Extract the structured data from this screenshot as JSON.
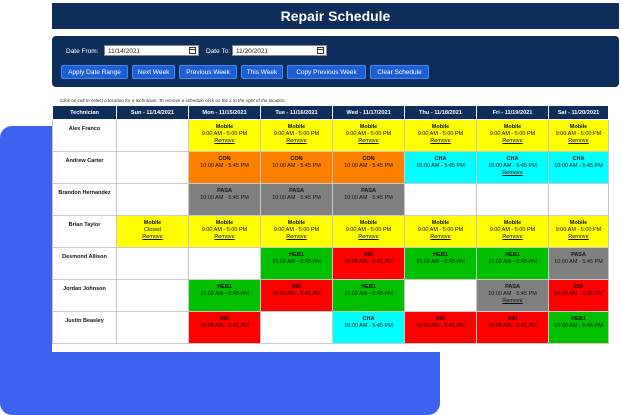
{
  "title": "Repair Schedule",
  "filters": {
    "date_from_label": "Date From:",
    "date_from_value": "11/14/2021",
    "date_to_label": "Date To:",
    "date_to_value": "11/20/2021",
    "buttons": [
      "Apply Date Range",
      "Next Week",
      "Previous Week",
      "This Week",
      "Copy Previous Week",
      "Clear Schedule"
    ]
  },
  "hint": "Click on cell to select a location for a technician. To remove a schedule click on the x to the right of the location.",
  "table": {
    "headers": [
      "Technician",
      "Sun - 11/14/2021",
      "Mon - 11/15/2021",
      "Tue - 11/16/2021",
      "Wed - 11/17/2021",
      "Thu - 11/18/2021",
      "Fri - 11/19/2021",
      "Sat - 11/20/2021"
    ],
    "remove_label": "Remove",
    "rows": [
      {
        "tech": "Alex Franco",
        "cells": [
          {
            "color": "empty"
          },
          {
            "color": "yellow",
            "loc": "Mobile",
            "time": "9:00 AM - 5:00 PM",
            "remove": true
          },
          {
            "color": "yellow",
            "loc": "Mobile",
            "time": "9:00 AM - 5:00 PM",
            "remove": true
          },
          {
            "color": "yellow",
            "loc": "Mobile",
            "time": "9:00 AM - 5:00 PM",
            "remove": true
          },
          {
            "color": "yellow",
            "loc": "Mobile",
            "time": "9:00 AM - 5:00 PM",
            "remove": true
          },
          {
            "color": "yellow",
            "loc": "Mobile",
            "time": "9:00 AM - 5:00 PM",
            "remove": true
          },
          {
            "color": "yellow",
            "loc": "Mobile",
            "time": "9:00 AM - 5:00 PM",
            "remove": true
          }
        ]
      },
      {
        "tech": "Andrew Carter",
        "cells": [
          {
            "color": "empty"
          },
          {
            "color": "orange",
            "loc": "CON",
            "time": "10:00 AM - 5:45 PM",
            "remove": false
          },
          {
            "color": "orange",
            "loc": "CON",
            "time": "10:00 AM - 5:45 PM",
            "remove": false
          },
          {
            "color": "orange",
            "loc": "CON",
            "time": "10:00 AM - 5:45 PM",
            "remove": false
          },
          {
            "color": "cyan",
            "loc": "CHA",
            "time": "10:00 AM - 5:45 PM",
            "remove": false
          },
          {
            "color": "cyan",
            "loc": "CHA",
            "time": "10:00 AM - 5:45 PM",
            "remove": true
          },
          {
            "color": "cyan",
            "loc": "CHA",
            "time": "10:00 AM - 5:45 PM",
            "remove": false
          }
        ]
      },
      {
        "tech": "Brandon Hernandez",
        "cells": [
          {
            "color": "empty"
          },
          {
            "color": "gray",
            "loc": "PASA",
            "time": "10:00 AM - 5:45 PM",
            "remove": false
          },
          {
            "color": "gray",
            "loc": "PASA",
            "time": "10:00 AM - 5:45 PM",
            "remove": false
          },
          {
            "color": "gray",
            "loc": "PASA",
            "time": "10:00 AM - 5:45 PM",
            "remove": false
          },
          {
            "color": "empty"
          },
          {
            "color": "empty"
          },
          {
            "color": "empty"
          }
        ]
      },
      {
        "tech": "Brian Taylor",
        "cells": [
          {
            "color": "yellow",
            "loc": "Mobile",
            "time": "Closed",
            "remove": true
          },
          {
            "color": "yellow",
            "loc": "Mobile",
            "time": "9:00 AM - 5:00 PM",
            "remove": true
          },
          {
            "color": "yellow",
            "loc": "Mobile",
            "time": "9:00 AM - 5:00 PM",
            "remove": true
          },
          {
            "color": "yellow",
            "loc": "Mobile",
            "time": "9:00 AM - 5:00 PM",
            "remove": true
          },
          {
            "color": "yellow",
            "loc": "Mobile",
            "time": "9:00 AM - 5:00 PM",
            "remove": true
          },
          {
            "color": "yellow",
            "loc": "Mobile",
            "time": "9:00 AM - 5:00 PM",
            "remove": true
          },
          {
            "color": "yellow",
            "loc": "Mobile",
            "time": "9:00 AM - 5:00 PM",
            "remove": true
          }
        ]
      },
      {
        "tech": "Desmond Allison",
        "cells": [
          {
            "color": "empty"
          },
          {
            "color": "empty"
          },
          {
            "color": "green",
            "loc": "HEB1",
            "time": "10:00 AM - 5:45 PM",
            "remove": false
          },
          {
            "color": "red",
            "loc": "290",
            "time": "10:00 AM - 5:45 PM",
            "remove": false
          },
          {
            "color": "green",
            "loc": "HEB1",
            "time": "10:00 AM - 5:45 PM",
            "remove": false
          },
          {
            "color": "green",
            "loc": "HEB1",
            "time": "10:00 AM - 5:45 PM",
            "remove": false
          },
          {
            "color": "gray",
            "loc": "PASA",
            "time": "10:00 AM - 5:45 PM",
            "remove": false
          }
        ]
      },
      {
        "tech": "Jordan Johnson",
        "cells": [
          {
            "color": "empty"
          },
          {
            "color": "green",
            "loc": "HEB1",
            "time": "10:00 AM - 5:45 PM",
            "remove": false
          },
          {
            "color": "red",
            "loc": "290",
            "time": "10:00 AM - 5:45 PM",
            "remove": false
          },
          {
            "color": "green",
            "loc": "HEB1",
            "time": "10:00 AM - 5:45 PM",
            "remove": false
          },
          {
            "color": "empty"
          },
          {
            "color": "gray",
            "loc": "PASA",
            "time": "10:00 AM - 5:45 PM",
            "remove": true
          },
          {
            "color": "red",
            "loc": "290",
            "time": "10:00 AM - 5:45 PM",
            "remove": false
          }
        ]
      },
      {
        "tech": "Justin Beasley",
        "cells": [
          {
            "color": "empty"
          },
          {
            "color": "red",
            "loc": "290",
            "time": "10:00 AM - 5:45 PM",
            "remove": false
          },
          {
            "color": "empty"
          },
          {
            "color": "cyan",
            "loc": "CHA",
            "time": "10:00 AM - 5:45 PM",
            "remove": false
          },
          {
            "color": "red",
            "loc": "290",
            "time": "10:00 AM - 5:45 PM",
            "remove": false
          },
          {
            "color": "red",
            "loc": "290",
            "time": "10:00 AM - 5:45 PM",
            "remove": false
          },
          {
            "color": "green",
            "loc": "HEB1",
            "time": "10:00 AM - 5:45 PM",
            "remove": false
          }
        ]
      }
    ]
  },
  "colors": {
    "header_navy": "#0d2d5a",
    "button_blue": "#1b5fd6",
    "backdrop_blue": "#3b63f0",
    "yellow": "#ffff00",
    "orange": "#ff7f00",
    "gray": "#808080",
    "cyan": "#00ffff",
    "green": "#00c000",
    "red": "#ff0000"
  }
}
